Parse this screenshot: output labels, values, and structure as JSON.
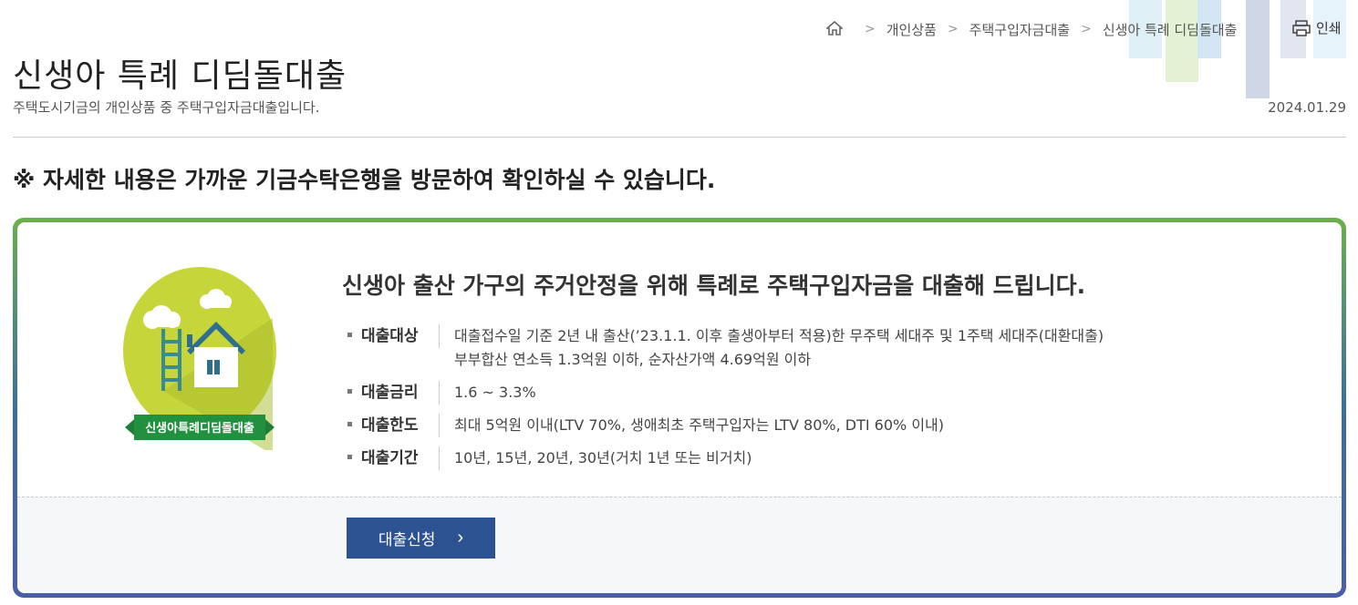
{
  "breadcrumb": {
    "items": [
      "개인상품",
      "주택구입자금대출",
      "신생아 특례 디딤돌대출"
    ]
  },
  "print_label": "인쇄",
  "page": {
    "title": "신생아 특례 디딤돌대출",
    "description": "주택도시기금의 개인상품 중 주택구입자금대출입니다.",
    "date": "2024.01.29"
  },
  "notice": "※ 자세한 내용은 가까운 기금수탁은행을 방문하여 확인하실 수 있습니다.",
  "card": {
    "emblem_label": "신생아특례디딤돌대출",
    "headline": "신생아 출산 가구의 주거안정을 위해 특례로 주택구입자금을 대출해 드립니다.",
    "info": [
      {
        "label": "대출대상",
        "lines": [
          "대출접수일 기준 2년 내 출산(’23.1.1. 이후 출생아부터 적용)한 무주택 세대주 및 1주택 세대주(대환대출)",
          "부부합산 연소득 1.3억원 이하, 순자산가액 4.69억원 이하"
        ]
      },
      {
        "label": "대출금리",
        "lines": [
          "1.6 ~ 3.3%"
        ]
      },
      {
        "label": "대출한도",
        "lines": [
          "최대 5억원 이내(LTV 70%, 생애최초 주택구입자는 LTV 80%, DTI 60% 이내)"
        ]
      },
      {
        "label": "대출기간",
        "lines": [
          "10년, 15년, 20년, 30년(거치 1년 또는 비거치)"
        ]
      }
    ],
    "apply_label": "대출신청"
  },
  "colors": {
    "accent_green": "#6ab04a",
    "accent_blue": "#2d5292"
  }
}
